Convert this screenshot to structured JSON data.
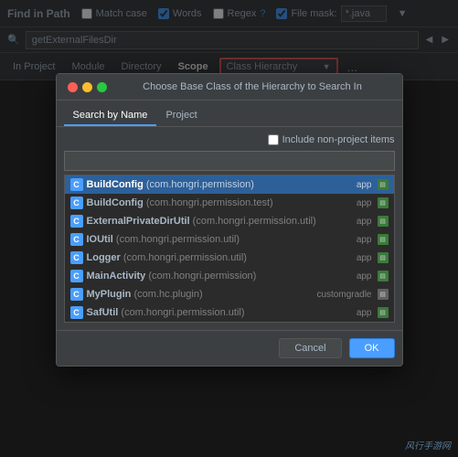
{
  "topbar": {
    "title": "Find in Path",
    "checkboxes": {
      "match_case_label": "Match case",
      "words_label": "Words",
      "regex_label": "Regex",
      "regex_question": "?",
      "file_mask_label": "File mask:",
      "file_mask_value": "*.java"
    },
    "filter_icon": "▼"
  },
  "search": {
    "placeholder": "",
    "value": "getExternalFilesDir",
    "arrow_left": "◀",
    "arrow_right": "▶"
  },
  "scope": {
    "tabs": [
      {
        "label": "In Project",
        "active": false
      },
      {
        "label": "Module",
        "active": false
      },
      {
        "label": "Directory",
        "active": false
      },
      {
        "label": "Scope",
        "active": true
      }
    ],
    "dropdown_text": "Class Hierarchy",
    "dropdown_arrow": "▼",
    "dots": "..."
  },
  "modal": {
    "title": "Choose Base Class of the Hierarchy to Search In",
    "traffic_lights": [
      "red",
      "yellow",
      "green"
    ],
    "tabs": [
      {
        "label": "Search by Name",
        "active": true
      },
      {
        "label": "Project",
        "active": false
      }
    ],
    "include_non_project": {
      "label": "Include non-project items",
      "checked": false
    },
    "search_placeholder": "",
    "search_value": "",
    "class_list": [
      {
        "id": 1,
        "icon": "C",
        "class_name": "BuildConfig",
        "package": "(com.hongri.permission)",
        "module": "app",
        "module_icon_type": "green",
        "selected": true
      },
      {
        "id": 2,
        "icon": "C",
        "class_name": "BuildConfig",
        "package": "(com.hongri.permission.test)",
        "module": "app",
        "module_icon_type": "green",
        "selected": false
      },
      {
        "id": 3,
        "icon": "C",
        "class_name": "ExternalPrivateDirUtil",
        "package": "(com.hongri.permission.util)",
        "module": "app",
        "module_icon_type": "green",
        "selected": false
      },
      {
        "id": 4,
        "icon": "C",
        "class_name": "IOUtil",
        "package": "(com.hongri.permission.util)",
        "module": "app",
        "module_icon_type": "green",
        "selected": false
      },
      {
        "id": 5,
        "icon": "C",
        "class_name": "Logger",
        "package": "(com.hongri.permission.util)",
        "module": "app",
        "module_icon_type": "green",
        "selected": false
      },
      {
        "id": 6,
        "icon": "C",
        "class_name": "MainActivity",
        "package": "(com.hongri.permission)",
        "module": "app",
        "module_icon_type": "green",
        "selected": false
      },
      {
        "id": 7,
        "icon": "C",
        "class_name": "MyPlugin",
        "package": "(com.hc.plugin)",
        "module": "customgradle",
        "module_icon_type": "default",
        "selected": false
      },
      {
        "id": 8,
        "icon": "C",
        "class_name": "SafUtil",
        "package": "(com.hongri.permission.util)",
        "module": "app",
        "module_icon_type": "green",
        "selected": false
      }
    ],
    "footer": {
      "cancel_label": "Cancel",
      "ok_label": "OK"
    }
  },
  "watermark": {
    "text": "风行手游网"
  }
}
